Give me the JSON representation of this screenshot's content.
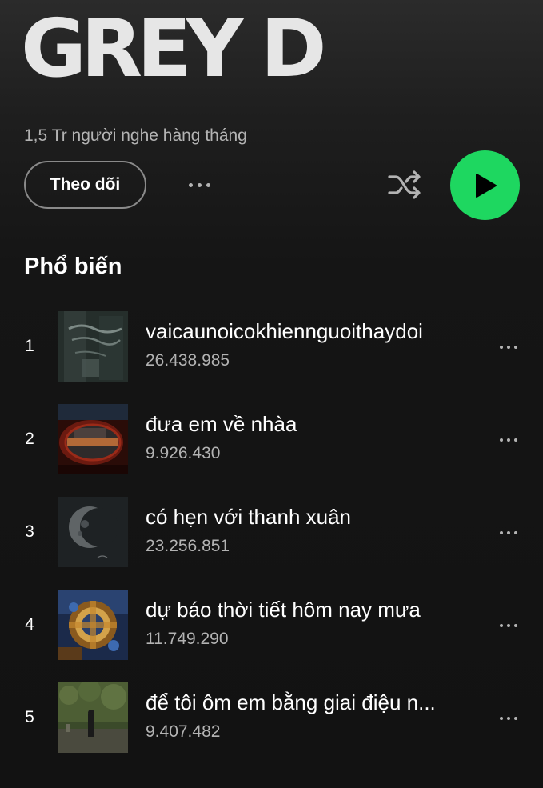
{
  "artist": {
    "name": "GREY D",
    "monthly_listeners": "1,5 Tr người nghe hàng tháng"
  },
  "actions": {
    "follow_label": "Theo dõi",
    "more_icon": "more-horizontal-icon",
    "shuffle_icon": "shuffle-icon",
    "play_icon": "play-icon",
    "play_color": "#1ed760"
  },
  "popular": {
    "title": "Phổ biến",
    "tracks": [
      {
        "number": "1",
        "title": "vaicaunoicokhiennguoithaydoi",
        "plays": "26.438.985"
      },
      {
        "number": "2",
        "title": "đưa em về nhàa",
        "plays": "9.926.430"
      },
      {
        "number": "3",
        "title": "có hẹn với thanh xuân",
        "plays": "23.256.851"
      },
      {
        "number": "4",
        "title": "dự báo thời tiết hôm nay mưa",
        "plays": "11.749.290"
      },
      {
        "number": "5",
        "title": "để tôi ôm em bằng giai điệu n...",
        "plays": "9.407.482"
      }
    ]
  }
}
